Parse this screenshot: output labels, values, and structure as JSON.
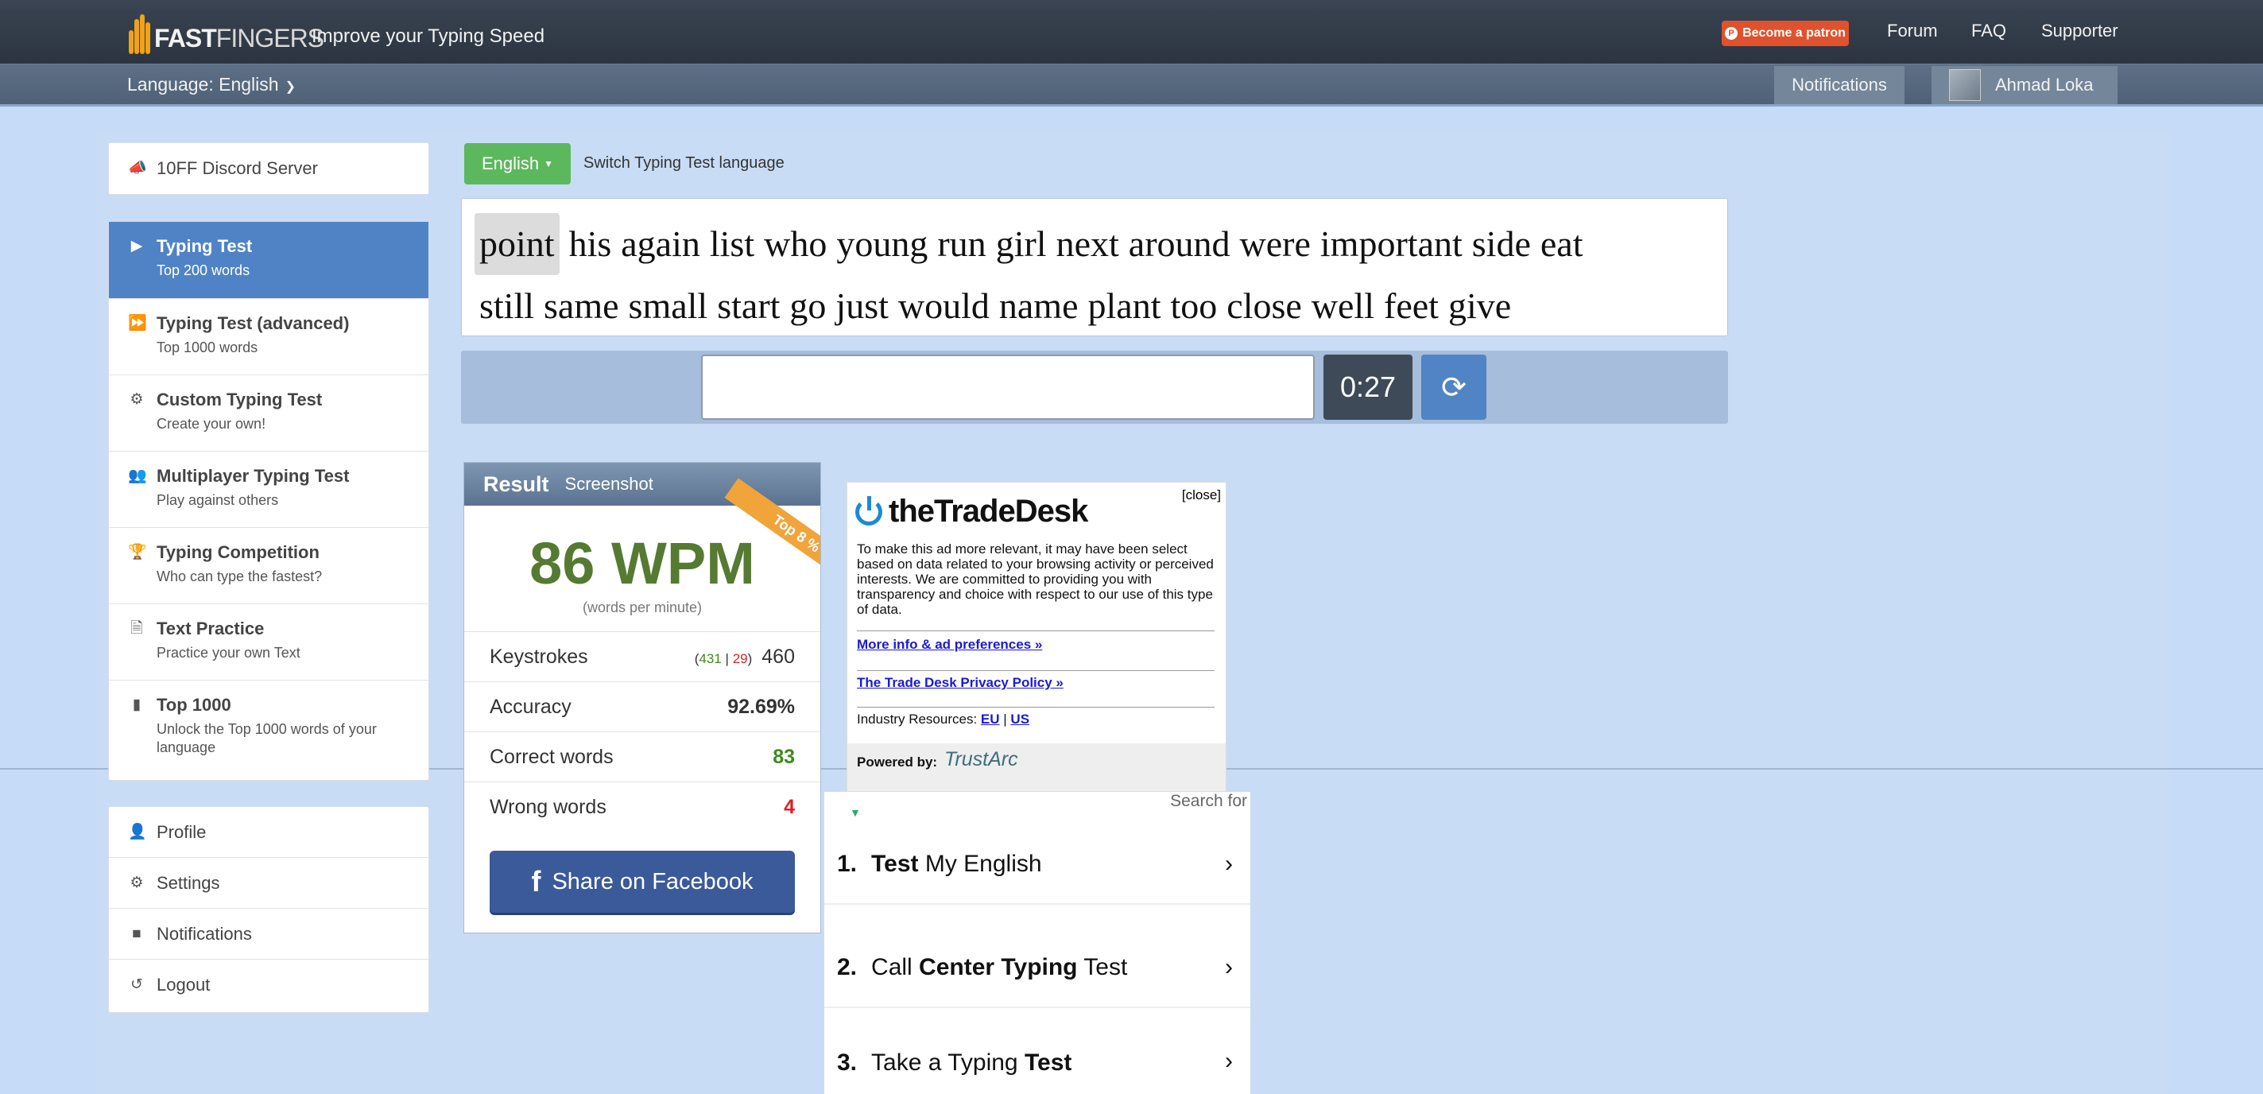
{
  "header": {
    "logo_left": "10",
    "logo_right": "FAST",
    "logo_tail": "FINGERS",
    "tagline": "Improve your Typing Speed",
    "patron_label": "Become a patron",
    "links": [
      "Forum",
      "FAQ",
      "Supporter"
    ],
    "language_label": "Language: English",
    "notifications_label": "Notifications",
    "user_name": "Ahmad Loka"
  },
  "sidebar": {
    "discord": "10FF Discord Server",
    "items": [
      {
        "title": "Typing Test",
        "sub": "Top 200 words",
        "icon": "play-icon"
      },
      {
        "title": "Typing Test (advanced)",
        "sub": "Top 1000 words",
        "icon": "fast-forward-icon"
      },
      {
        "title": "Custom Typing Test",
        "sub": "Create your own!",
        "icon": "gears-icon"
      },
      {
        "title": "Multiplayer Typing Test",
        "sub": "Play against others",
        "icon": "users-icon"
      },
      {
        "title": "Typing Competition",
        "sub": "Who can type the fastest?",
        "icon": "trophy-icon"
      },
      {
        "title": "Text Practice",
        "sub": "Practice your own Text",
        "icon": "document-icon"
      },
      {
        "title": "Top 1000",
        "sub": "Unlock the Top 1000 words of your language",
        "icon": "signal-icon"
      }
    ],
    "account": [
      "Profile",
      "Settings",
      "Notifications",
      "Logout"
    ]
  },
  "typing": {
    "language_button": "English",
    "switch_label": "Switch Typing Test language",
    "words_line1": [
      "point",
      "his",
      "again",
      "list",
      "who",
      "young",
      "run",
      "girl",
      "next",
      "around",
      "were",
      "important",
      "side",
      "eat"
    ],
    "words_line2": [
      "still",
      "same",
      "small",
      "start",
      "go",
      "just",
      "would",
      "name",
      "plant",
      "too",
      "close",
      "well",
      "feet",
      "give"
    ],
    "timer": "0:27"
  },
  "result": {
    "title": "Result",
    "screenshot": "Screenshot",
    "ribbon": "Top 8 %",
    "wpm": "86 WPM",
    "wpm_sub": "(words per minute)",
    "keystrokes_label": "Keystrokes",
    "keystrokes_correct": "431",
    "keystrokes_sep": "|",
    "keystrokes_wrong": "29",
    "keystrokes_total": "460",
    "accuracy_label": "Accuracy",
    "accuracy": "92.69%",
    "correct_label": "Correct words",
    "correct": "83",
    "wrong_label": "Wrong words",
    "wrong": "4",
    "share": "Share on Facebook"
  },
  "ad": {
    "close": "[close]",
    "brand": "theTradeDesk",
    "text": "To make this ad more relevant, it may have been select based on data related to your browsing activity or perceived interests. We are committed to providing you with transparency and choice with respect to our use of this type of data.",
    "link1": "More info & ad preferences »",
    "link2": "The Trade Desk Privacy Policy »",
    "industry_label": "Industry Resources:",
    "eu": "EU",
    "us": "US",
    "powered": "Powered by:",
    "trustarc": "TrustArc"
  },
  "search_ad": {
    "search_for": "Search for",
    "rows": [
      {
        "num": "1.",
        "bold1": "Test",
        "text": " My English"
      },
      {
        "num": "2.",
        "pre": "Call ",
        "bold1": "Center Typing",
        "text": " Test"
      },
      {
        "num": "3.",
        "pre": "Take a Typing ",
        "bold1": "Test",
        "text": ""
      }
    ]
  }
}
